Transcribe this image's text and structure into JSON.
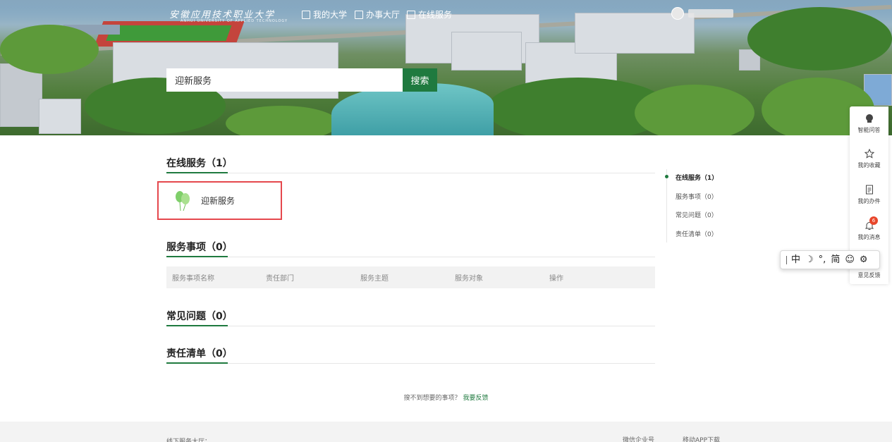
{
  "header": {
    "logo_text": "安徽应用技术职业大学",
    "logo_sub": "ANHUI UNIVERSITY OF APPLIED TECHNOLOGY",
    "nav": [
      {
        "label": "我的大学",
        "icon": "university-icon"
      },
      {
        "label": "办事大厅",
        "icon": "hall-icon"
      },
      {
        "label": "在线服务",
        "icon": "service-icon"
      }
    ]
  },
  "search": {
    "value": "迎新服务",
    "button_label": "搜索"
  },
  "sections": {
    "online": {
      "title": "在线服务（1）"
    },
    "service_items": {
      "title": "服务事项（0）"
    },
    "faq": {
      "title": "常见问题（0）"
    },
    "duty": {
      "title": "责任清单（0）"
    }
  },
  "online_services": [
    {
      "label": "迎新服务",
      "icon": "balloon-icon"
    }
  ],
  "table": {
    "columns": [
      "服务事项名称",
      "责任部门",
      "服务主题",
      "服务对象",
      "操作"
    ]
  },
  "anchor_nav": [
    {
      "label": "在线服务（1）",
      "active": true
    },
    {
      "label": "服务事项（0）",
      "active": false
    },
    {
      "label": "常见问题（0）",
      "active": false
    },
    {
      "label": "责任清单（0）",
      "active": false
    }
  ],
  "feedback": {
    "text": "搜不到想要的事项？",
    "link": "我要反馈"
  },
  "footer": {
    "left": "线下服务大厅：",
    "wechat": "微信企业号",
    "app": "移动APP下载"
  },
  "float_bar": {
    "items": [
      {
        "label": "智能问答",
        "icon": "assistant-icon"
      },
      {
        "label": "我的收藏",
        "icon": "star-icon"
      },
      {
        "label": "我的办件",
        "icon": "document-icon"
      },
      {
        "label": "我的消息",
        "icon": "bell-icon",
        "badge": "6"
      },
      {
        "label": "意见反馈",
        "icon": "feedback-icon"
      }
    ]
  },
  "ime": {
    "items": [
      "中",
      "☽",
      "°,",
      "简",
      "☺",
      "⚙"
    ]
  },
  "colors": {
    "accent": "#1f7a3f",
    "highlight_border": "#e5484d",
    "badge": "#e8462b"
  }
}
